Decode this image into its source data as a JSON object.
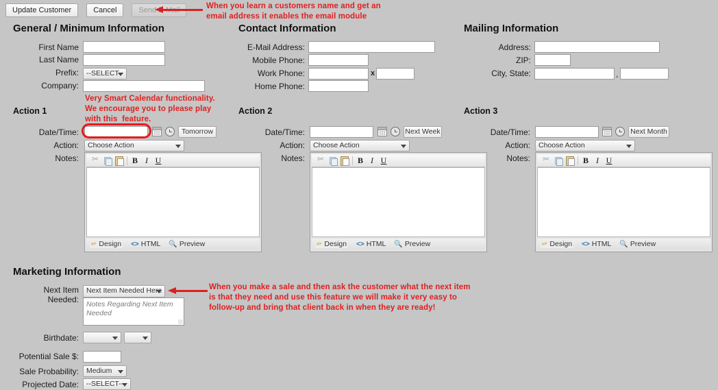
{
  "toolbar": {
    "update_label": "Update Customer",
    "cancel_label": "Cancel",
    "email_label": "Send E-Mail"
  },
  "annotations": {
    "email": "When you learn a customers name and get an\nemail address it enables the email module",
    "calendar": "Very Smart Calendar functionality.\nWe encourage you to please play\nwith this  feature.",
    "next_item": "When you make a sale and then ask the customer what the next item\nis that they need and use this feature we will make it very easy to\nfollow-up and bring that client back in when they are ready!",
    "color": "#e02020"
  },
  "sections": {
    "general": {
      "title": "General / Minimum Information",
      "fields": {
        "first_name_label": "First Name",
        "last_name_label": "Last Name",
        "prefix_label": "Prefix:",
        "company_label": "Company:",
        "first_name_value": "",
        "last_name_value": "",
        "prefix_value": "--SELECT--",
        "company_value": ""
      }
    },
    "contact": {
      "title": "Contact Information",
      "fields": {
        "email_label": "E-Mail Address:",
        "mobile_label": "Mobile Phone:",
        "work_label": "Work Phone:",
        "home_label": "Home Phone:",
        "ext_separator": "x",
        "email_value": "",
        "mobile_value": "",
        "work_value": "",
        "work_ext_value": "",
        "home_value": ""
      }
    },
    "mailing": {
      "title": "Mailing Information",
      "fields": {
        "address_label": "Address:",
        "zip_label": "ZIP:",
        "city_state_label": "City, State:",
        "separator": ",",
        "address_value": "",
        "zip_value": "",
        "city_value": "",
        "state_value": ""
      }
    },
    "marketing": {
      "title": "Marketing Information",
      "fields": {
        "next_item_label_line1": "Next Item",
        "next_item_label_line2": "Needed:",
        "next_item_value": "Next Item Needed Here",
        "next_item_notes_placeholder": "Notes Regarding Next Item Needed",
        "birthdate_label": "Birthdate:",
        "birthdate_month_value": "",
        "birthdate_day_value": "",
        "potential_sale_label": "Potential Sale $:",
        "potential_sale_value": "",
        "sale_probability_label": "Sale Probability:",
        "sale_probability_value": "Medium",
        "projected_date_label": "Projected Date:",
        "projected_date_value": "--SELECT--"
      }
    }
  },
  "actions": [
    {
      "title": "Action 1",
      "datetime_label": "Date/Time:",
      "datetime_value": "",
      "quick_button": "Tomorrow",
      "action_label": "Action:",
      "action_value": "Choose Action",
      "notes_label": "Notes:",
      "notes_value": "",
      "highlighted": true
    },
    {
      "title": "Action 2",
      "datetime_label": "Date/Time:",
      "datetime_value": "",
      "quick_button": "Next Week",
      "action_label": "Action:",
      "action_value": "Choose Action",
      "notes_label": "Notes:",
      "notes_value": "",
      "highlighted": false
    },
    {
      "title": "Action 3",
      "datetime_label": "Date/Time:",
      "datetime_value": "",
      "quick_button": "Next Month",
      "action_label": "Action:",
      "action_value": "Choose Action",
      "notes_label": "Notes:",
      "notes_value": "",
      "highlighted": false
    }
  ],
  "editor": {
    "tools": [
      "cut-icon",
      "copy-icon",
      "paste-icon",
      "bold-icon",
      "italic-icon",
      "underline-icon"
    ],
    "bold": "B",
    "italic": "I",
    "underline": "U",
    "tabs": [
      "Design",
      "HTML",
      "Preview"
    ]
  }
}
